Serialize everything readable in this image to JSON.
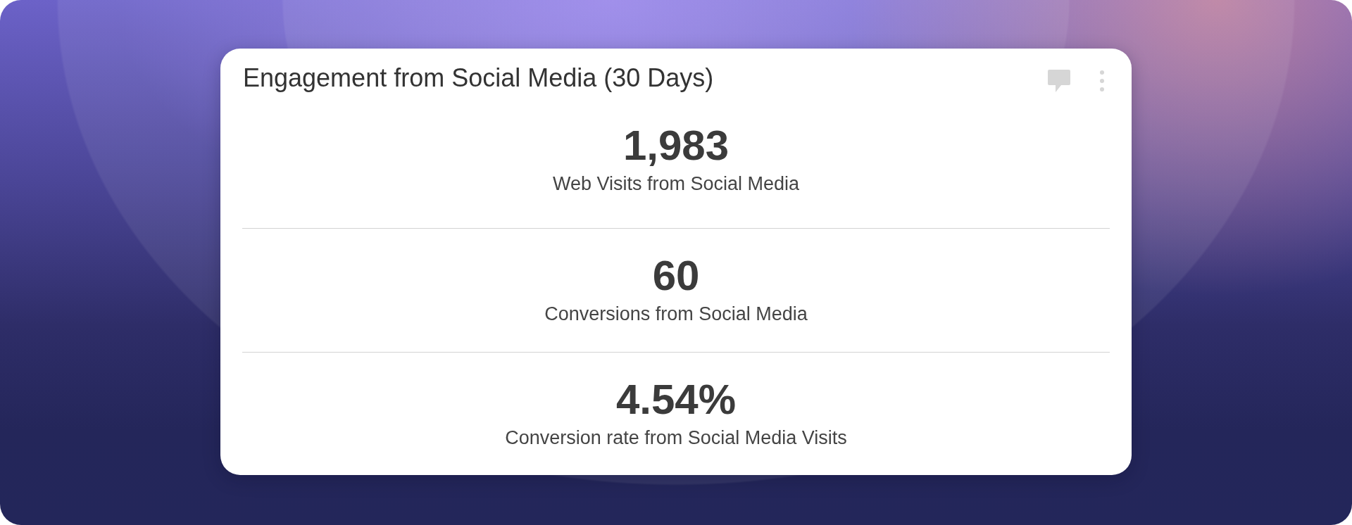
{
  "card": {
    "title": "Engagement from Social Media (30 Days)",
    "metrics": [
      {
        "value": "1,983",
        "label": "Web Visits from Social Media"
      },
      {
        "value": "60",
        "label": "Conversions from Social Media"
      },
      {
        "value": "4.54%",
        "label": "Conversion rate from Social Media Visits"
      }
    ]
  }
}
